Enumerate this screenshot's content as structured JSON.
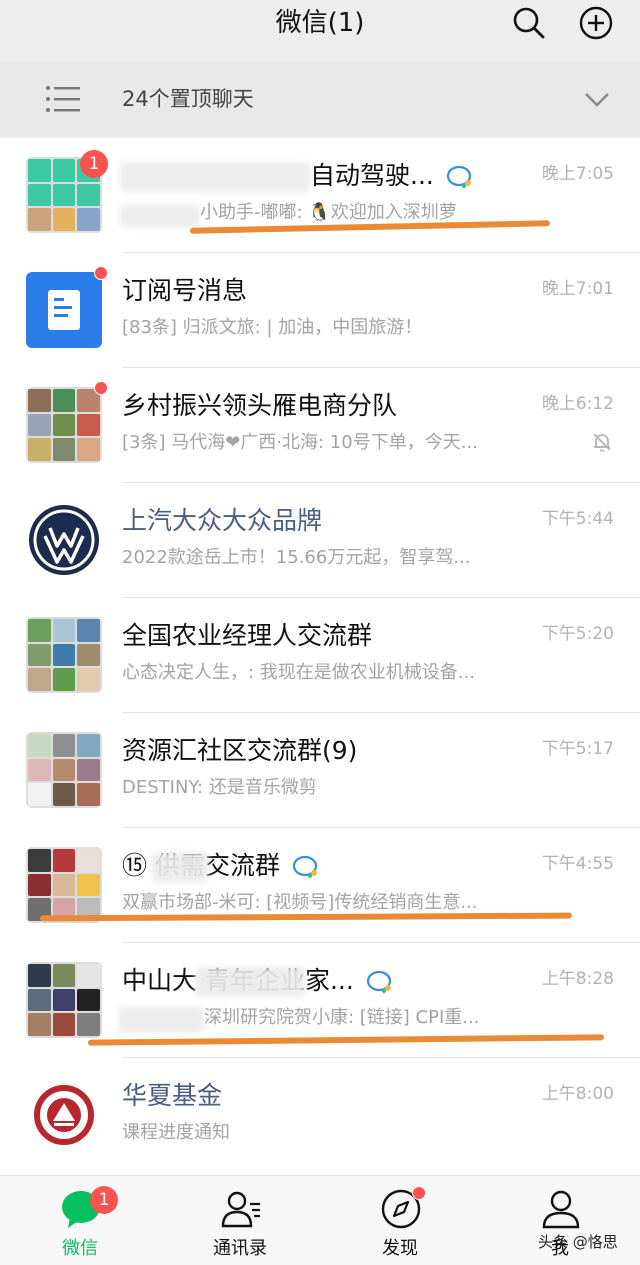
{
  "header": {
    "title": "微信(1)",
    "search_icon": "search-icon",
    "add_icon": "plus-circle-icon"
  },
  "pinned": {
    "label": "24个置顶聊天",
    "icon": "list-icon",
    "chevron": "chevron-down-icon"
  },
  "chats": [
    {
      "name": "自动驾驶...",
      "preview": "小助手-嘟嘟: 🐧欢迎加入深圳萝",
      "time": "晚上7:05",
      "badge": "1",
      "wx_tag": true
    },
    {
      "name": "订阅号消息",
      "preview": "[83条] 归派文旅: | 加油，中国旅游！",
      "time": "晚上7:01",
      "dot": true
    },
    {
      "name": "乡村振兴领头雁电商分队",
      "preview": "[3条] 马代海❤广西·北海: 10号下单，今天...",
      "time": "晚上6:12",
      "dot": true,
      "muted": true
    },
    {
      "name": "上汽大众大众品牌",
      "preview": "2022款途岳上市！15.66万元起，智享驾...",
      "time": "下午5:44"
    },
    {
      "name": "全国农业经理人交流群",
      "preview": "心态决定人生，: 我现在是做农业机械设备...",
      "time": "下午5:20"
    },
    {
      "name": "资源汇社区交流群(9)",
      "preview": "DESTINY: 还是音乐微剪",
      "time": "下午5:17"
    },
    {
      "name": "⑮ 供需交流群",
      "preview": "双赢市场部-米可: [视频号]传统经销商生意...",
      "time": "下午4:55",
      "wx_tag": true
    },
    {
      "name": "中山大 青年企业家...",
      "preview": "深圳研究院贺小康: [链接] CPI重...",
      "time": "上午8:28",
      "wx_tag": true
    },
    {
      "name": "华夏基金",
      "preview": "课程进度通知",
      "time": "上午8:00"
    }
  ],
  "tabs": [
    {
      "label": "微信",
      "icon": "chat-bubble-icon",
      "badge": "1"
    },
    {
      "label": "通讯录",
      "icon": "contacts-icon"
    },
    {
      "label": "发现",
      "icon": "compass-icon"
    },
    {
      "label": "我",
      "icon": "person-icon"
    }
  ],
  "watermark": "头条 @恪思",
  "colors": {
    "accent_green": "#07c160",
    "badge_red": "#fa5151",
    "official_blue": "#4a5d87",
    "annotation_orange": "#ea8a37"
  }
}
